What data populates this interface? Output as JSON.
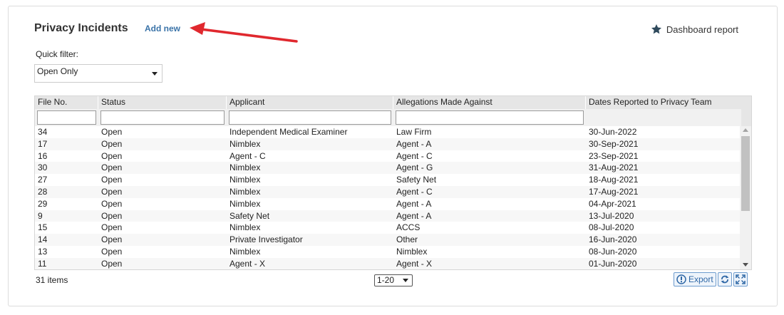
{
  "header": {
    "title": "Privacy Incidents",
    "add_new_label": "Add new",
    "dashboard_label": "Dashboard report"
  },
  "quick_filter": {
    "label": "Quick filter:",
    "selected": "Open Only"
  },
  "table": {
    "columns": [
      "File No.",
      "Status",
      "Applicant",
      "Allegations Made Against",
      "Dates Reported to Privacy Team"
    ],
    "rows": [
      [
        "34",
        "Open",
        "Independent Medical Examiner",
        "Law Firm",
        "30-Jun-2022"
      ],
      [
        "17",
        "Open",
        "Nimblex",
        "Agent - A",
        "30-Sep-2021"
      ],
      [
        "16",
        "Open",
        "Agent - C",
        "Agent - C",
        "23-Sep-2021"
      ],
      [
        "30",
        "Open",
        "Nimblex",
        "Agent - G",
        "31-Aug-2021"
      ],
      [
        "27",
        "Open",
        "Nimblex",
        "Safety Net",
        "18-Aug-2021"
      ],
      [
        "28",
        "Open",
        "Nimblex",
        "Agent - C",
        "17-Aug-2021"
      ],
      [
        "29",
        "Open",
        "Nimblex",
        "Agent - A",
        "04-Apr-2021"
      ],
      [
        "9",
        "Open",
        "Safety Net",
        "Agent - A",
        "13-Jul-2020"
      ],
      [
        "15",
        "Open",
        "Nimblex",
        "ACCS",
        "08-Jul-2020"
      ],
      [
        "14",
        "Open",
        "Private Investigator",
        "Other",
        "16-Jun-2020"
      ],
      [
        "13",
        "Open",
        "Nimblex",
        "Nimblex",
        "08-Jun-2020"
      ],
      [
        "11",
        "Open",
        "Agent - X",
        "Agent - X",
        "01-Jun-2020"
      ]
    ]
  },
  "footer": {
    "count_label": "31 items",
    "pager_value": "1-20",
    "export_label": "Export"
  },
  "colors": {
    "link": "#3a73a8",
    "arrow": "#e0282e",
    "header_bg": "#e6e6e6"
  }
}
